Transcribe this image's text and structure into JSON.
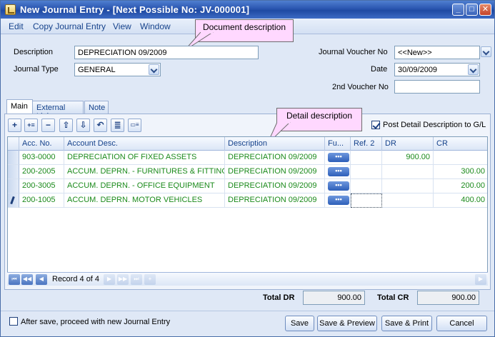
{
  "window": {
    "title": "New Journal Entry - [Next Possible No: JV-000001]",
    "controls": {
      "minimize": "_",
      "maximize": "□",
      "close": "✕"
    }
  },
  "menu": [
    "Edit",
    "Copy Journal Entry",
    "View",
    "Window"
  ],
  "callouts": {
    "document": "Document description",
    "detail": "Detail description"
  },
  "form": {
    "description_label": "Description",
    "description_value": "DEPRECIATION 09/2009",
    "journal_type_label": "Journal Type",
    "journal_type_value": "GENERAL",
    "voucher_label": "Journal Voucher No",
    "voucher_value": "<<New>>",
    "date_label": "Date",
    "date_value": "30/09/2009",
    "second_voucher_label": "2nd Voucher No",
    "second_voucher_value": ""
  },
  "tabs": [
    "Main",
    "External Link",
    "Note"
  ],
  "toolbar_icons": [
    "add-row-icon",
    "insert-row-icon",
    "delete-row-icon",
    "move-up-icon",
    "move-down-icon",
    "undo-icon",
    "list-icon",
    "detail-view-icon"
  ],
  "toolbar_glyphs": [
    "+",
    "+≡",
    "−",
    "⇧",
    "⇩",
    "↶",
    "≣",
    "▭≡"
  ],
  "post_detail": {
    "label": "Post Detail Description to G/L",
    "checked": true
  },
  "grid": {
    "columns": [
      "Acc. No.",
      "Account Desc.",
      "Description",
      "Fu...",
      "Ref. 2",
      "DR",
      "CR"
    ],
    "rows": [
      {
        "acc_no": "903-0000",
        "acc_desc": "DEPRECIATION OF FIXED ASSETS",
        "description": "DEPRECIATION 09/2009",
        "fu": "•••",
        "ref2": "",
        "dr": "900.00",
        "cr": ""
      },
      {
        "acc_no": "200-2005",
        "acc_desc": "ACCUM. DEPRN. - FURNITURES & FITTINGS",
        "description": "DEPRECIATION 09/2009",
        "fu": "•••",
        "ref2": "",
        "dr": "",
        "cr": "300.00"
      },
      {
        "acc_no": "200-3005",
        "acc_desc": "ACCUM. DEPRN. - OFFICE EQUIPMENT",
        "description": "DEPRECIATION 09/2009",
        "fu": "•••",
        "ref2": "",
        "dr": "",
        "cr": "200.00"
      },
      {
        "acc_no": "200-1005",
        "acc_desc": "ACCUM. DEPRN. MOTOR VEHICLES",
        "description": "DEPRECIATION 09/2009",
        "fu": "•••",
        "ref2": "",
        "dr": "",
        "cr": "400.00"
      }
    ]
  },
  "navigator": {
    "record_text": "Record 4 of 4",
    "glyphs": {
      "first_first": "⏮",
      "first": "◀◀",
      "prev": "◀",
      "next": "▶",
      "next_page": "▶▶",
      "last": "⏭",
      "add": "+"
    }
  },
  "totals": {
    "total_dr_label": "Total DR",
    "total_dr_value": "900.00",
    "total_cr_label": "Total CR",
    "total_cr_value": "900.00"
  },
  "footer": {
    "proceed_label": "After save, proceed with new Journal Entry",
    "proceed_checked": false,
    "save": "Save",
    "save_preview": "Save & Preview",
    "save_print": "Save & Print",
    "cancel": "Cancel"
  }
}
